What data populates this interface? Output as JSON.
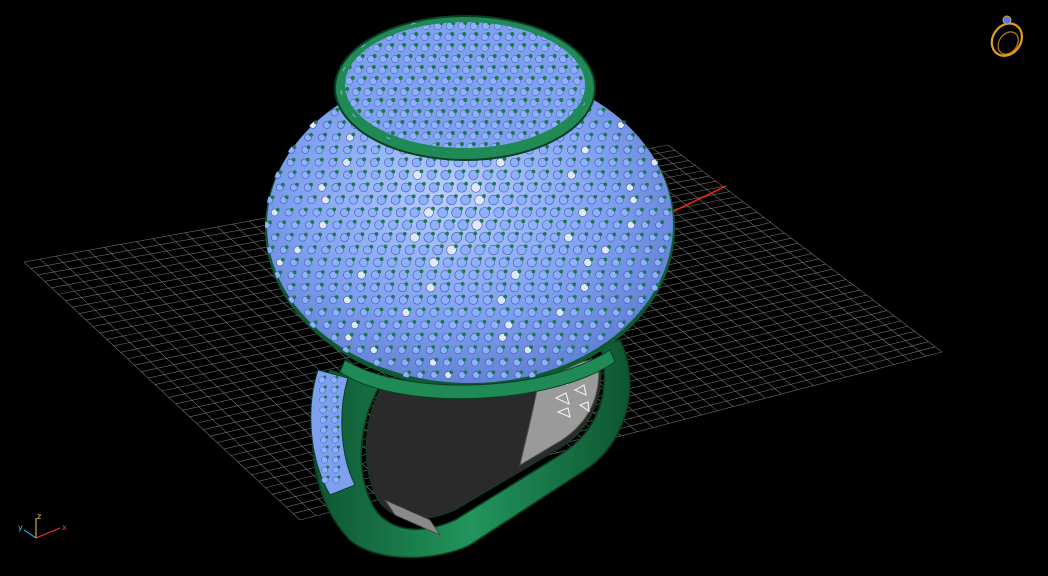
{
  "viewport": {
    "background": "#000000",
    "grid_color": "#8a8a8a",
    "x_axis_color": "#ff2020",
    "mode": "3d-perspective",
    "render_style": "shaded-with-edges"
  },
  "model": {
    "description_kind": "pave-dome-ring",
    "metal_color": "#1f8a55",
    "metal_dark": "#0f5a33",
    "gem_color": "#8fb0ff",
    "gem_highlight": "#dfe8ff",
    "prong_color": "#1c7a4a",
    "inner_shank_color": "#9a9a9a"
  },
  "axis_triad": {
    "x_label": "x",
    "y_label": "y",
    "z_label": "z",
    "x_color": "#ff3030",
    "y_color": "#39c9ff",
    "z_color": "#ffd23a"
  },
  "view_cube": {
    "icon": "ring-icon",
    "color": "#e0a020",
    "gem_color": "#4a7bff"
  }
}
